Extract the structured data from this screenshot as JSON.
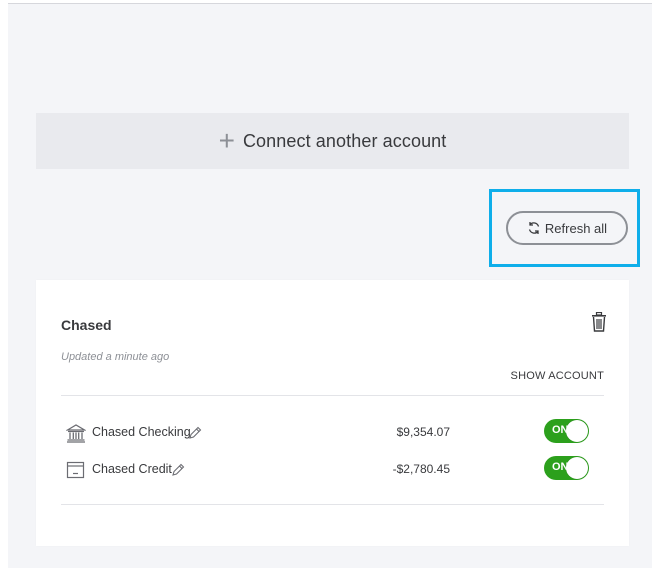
{
  "connect": {
    "label": "Connect another account"
  },
  "refresh": {
    "label": "Refresh all"
  },
  "bank": {
    "name": "Chased",
    "updated": "Updated a minute ago",
    "show_account": "SHOW ACCOUNT",
    "accounts": [
      {
        "name": "Chased Checking",
        "balance": "$9,354.07",
        "toggle": "ON",
        "icon": "bank-icon"
      },
      {
        "name": "Chased Credit",
        "balance": "-$2,780.45",
        "toggle": "ON",
        "icon": "credit-card-icon"
      }
    ]
  },
  "colors": {
    "accent_green": "#2ca01c",
    "highlight_blue": "#0eaeea",
    "panel_bg": "#f4f5f8"
  }
}
